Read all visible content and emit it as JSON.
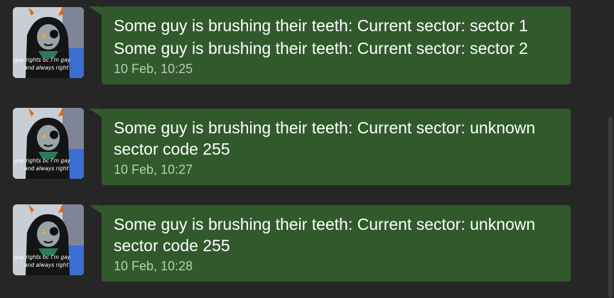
{
  "messages": [
    {
      "lines": [
        "Some guy is brushing their teeth: Current sector: sector 1",
        "Some guy is brushing their teeth: Current sector: sector 2"
      ],
      "time": "10 Feb, 10:25"
    },
    {
      "lines": [
        "Some guy is brushing their teeth: Current sector: unknown sector code 255"
      ],
      "time": "10 Feb, 10:27"
    },
    {
      "lines": [
        "Some guy is brushing their teeth: Current sector: unknown sector code 255"
      ],
      "time": "10 Feb, 10:28"
    }
  ],
  "avatar_caption": [
    "gay rights bc I'm gay",
    "and always right"
  ],
  "colors": {
    "background": "#262626",
    "bubble": "#31592c",
    "timestamp": "#b9cbb6"
  }
}
